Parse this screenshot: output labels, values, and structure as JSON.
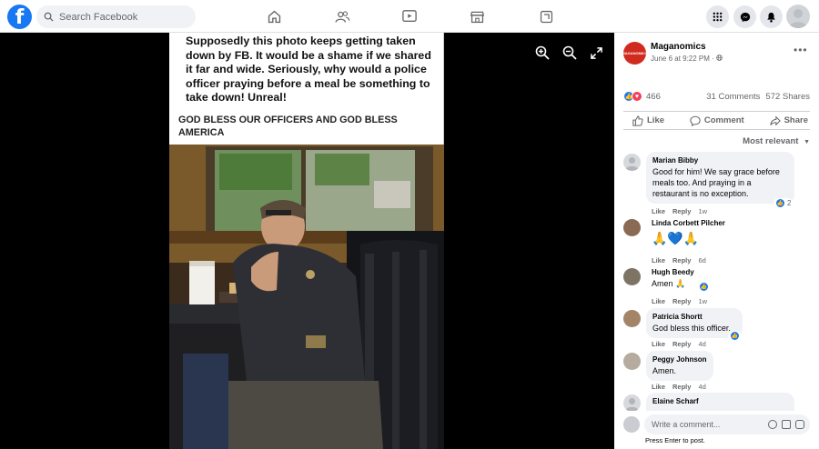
{
  "topbar": {
    "logo_letter": "f",
    "search_placeholder": "Search Facebook",
    "nav_icons": [
      "home-icon",
      "friends-icon",
      "watch-icon",
      "marketplace-icon",
      "gaming-icon"
    ],
    "right_icons": [
      "menu-grid-icon",
      "messenger-icon",
      "notifications-icon",
      "account-avatar"
    ]
  },
  "post_image": {
    "caption_text": "Supposedly this photo keeps getting taken down by FB.  It would be a shame if we shared it far and wide.  Seriously, why would a police officer praying before a meal be something to take down! Unreal!",
    "banner_text": "GOD BLESS OUR OFFICERS AND GOD BLESS AMERICA"
  },
  "viewer_controls": [
    "zoom-in-icon",
    "zoom-out-icon",
    "fullscreen-icon"
  ],
  "post": {
    "page_avatar_text": "MAGANOMICS",
    "page_name": "Maganomics",
    "time": "June 6 at 9:22 PM · ",
    "reaction_count": "466",
    "comments_count": "31 Comments",
    "shares_count": "572 Shares",
    "like_label": "Like",
    "comment_label": "Comment",
    "share_label": "Share",
    "sort_label": "Most relevant"
  },
  "comments": [
    {
      "name": "Marian Bibby",
      "text": "Good for him! We say grace before meals too. And praying in a restaurant is no exception.",
      "like": "Like",
      "reply": "Reply",
      "time": "1w",
      "reactions": "2"
    },
    {
      "name": "Linda Corbett Pilcher",
      "text": "🙏💙🙏",
      "like": "Like",
      "reply": "Reply",
      "time": "6d"
    },
    {
      "name": "Hugh Beedy",
      "text": "Amen 🙏",
      "like": "Like",
      "reply": "Reply",
      "time": "1w"
    },
    {
      "name": "Patricia Shortt",
      "text": "God bless this officer.",
      "like": "Like",
      "reply": "Reply",
      "time": "4d"
    },
    {
      "name": "Peggy Johnson",
      "text": "Amen.",
      "like": "Like",
      "reply": "Reply",
      "time": "4d"
    },
    {
      "name": "Elaine Scharf",
      "text": ""
    }
  ],
  "composer": {
    "placeholder": "Write a comment...",
    "hint": "Press Enter to post."
  },
  "colors": {
    "brand": "#1877f2",
    "page_avatar": "#d12b1f",
    "bubble": "#f0f2f5"
  }
}
